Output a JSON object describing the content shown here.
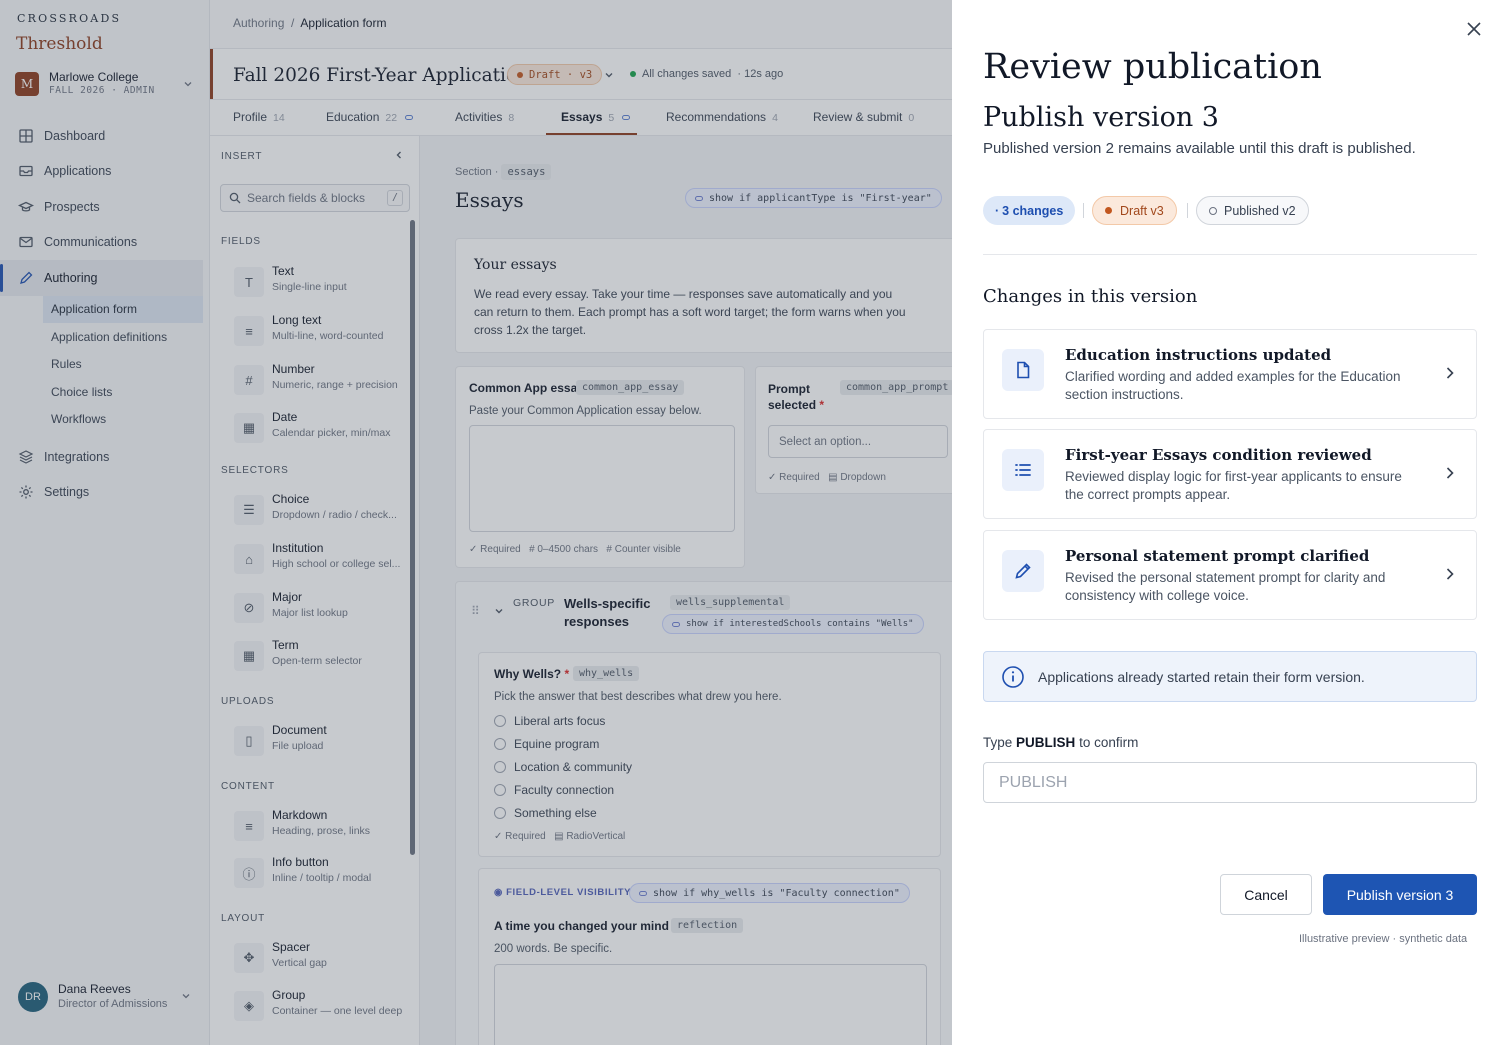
{
  "brand": {
    "line1": "CROSSROADS",
    "line2": "Threshold"
  },
  "org": {
    "initial": "M",
    "name": "Marlowe College",
    "meta": "FALL 2026 · ADMIN"
  },
  "nav": {
    "dashboard": "Dashboard",
    "applications": "Applications",
    "prospects": "Prospects",
    "communications": "Communications",
    "authoring": "Authoring",
    "sub": [
      "Application form",
      "Application definitions",
      "Rules",
      "Choice lists",
      "Workflows"
    ],
    "integrations": "Integrations",
    "settings": "Settings"
  },
  "user": {
    "initials": "DR",
    "name": "Dana Reeves",
    "role": "Director of Admissions"
  },
  "breadcrumb": {
    "parent": "Authoring",
    "sep": "/",
    "current": "Application form"
  },
  "form": {
    "title": "Fall 2026 First-Year Application",
    "badge": "Draft · v3",
    "saved": "All changes saved",
    "saved_when": "·  12s ago"
  },
  "tabs": [
    {
      "label": "Profile",
      "count": "14"
    },
    {
      "label": "Education",
      "count": "22"
    },
    {
      "label": "Activities",
      "count": "8"
    },
    {
      "label": "Essays",
      "count": "5"
    },
    {
      "label": "Recommendations",
      "count": "4"
    },
    {
      "label": "Review & submit",
      "count": "0"
    }
  ],
  "insert": {
    "header": "INSERT",
    "search_placeholder": "Search fields & blocks",
    "search_key": "/",
    "groups": {
      "fields": "FIELDS",
      "selectors": "SELECTORS",
      "uploads": "UPLOADS",
      "content": "CONTENT",
      "layout": "LAYOUT"
    },
    "items": [
      {
        "icon": "T",
        "label": "Text",
        "desc": "Single-line input"
      },
      {
        "icon": "≡",
        "label": "Long text",
        "desc": "Multi-line, word-counted"
      },
      {
        "icon": "#",
        "label": "Number",
        "desc": "Numeric, range + precision"
      },
      {
        "icon": "▦",
        "label": "Date",
        "desc": "Calendar picker, min/max"
      },
      {
        "icon": "☰",
        "label": "Choice",
        "desc": "Dropdown / radio / check..."
      },
      {
        "icon": "⌂",
        "label": "Institution",
        "desc": "High school or college sel..."
      },
      {
        "icon": "⊘",
        "label": "Major",
        "desc": "Major list lookup"
      },
      {
        "icon": "▦",
        "label": "Term",
        "desc": "Open-term selector"
      },
      {
        "icon": "▯",
        "label": "Document",
        "desc": "File upload"
      },
      {
        "icon": "≡",
        "label": "Markdown",
        "desc": "Heading, prose, links"
      },
      {
        "icon": "ⓘ",
        "label": "Info button",
        "desc": "Inline / tooltip / modal"
      },
      {
        "icon": "✥",
        "label": "Spacer",
        "desc": "Vertical gap"
      },
      {
        "icon": "◈",
        "label": "Group",
        "desc": "Container — one level deep"
      }
    ]
  },
  "section": {
    "label": "Section",
    "key": "essays",
    "title": "Essays",
    "visibility": "show if applicantType is \"First-year\""
  },
  "intro": {
    "title": "Your essays",
    "body": "We read every essay. Take your time — responses save automatically and you can return to them. Each prompt has a soft word target; the form warns when you cross 1.2x the target."
  },
  "common": {
    "label": "Common App essay",
    "key": "common_app_essay",
    "help": "Paste your Common Application essay below.",
    "meta": [
      "✓ Required",
      "# 0–4500 chars",
      "# Counter visible"
    ]
  },
  "prompt": {
    "label": "Prompt selected",
    "key": "common_app_prompt",
    "placeholder": "Select an option...",
    "meta": [
      "✓ Required",
      "▤ Dropdown"
    ]
  },
  "group": {
    "tag": "GROUP",
    "title": "Wells-specific responses",
    "key": "wells_supplemental",
    "visibility": "show if interestedSchools contains \"Wells\""
  },
  "why": {
    "label": "Why Wells?",
    "key": "why_wells",
    "help": "Pick the answer that best describes what drew you here.",
    "options": [
      "Liberal arts focus",
      "Equine program",
      "Location & community",
      "Faculty connection",
      "Something else"
    ],
    "meta": [
      "✓ Required",
      "▤ RadioVertical"
    ]
  },
  "reflection": {
    "tag": "FIELD-LEVEL VISIBILITY",
    "visibility": "show if why_wells is \"Faculty connection\"",
    "label": "A time you changed your mind",
    "key": "reflection",
    "help": "200 words. Be specific."
  },
  "panel": {
    "title": "Review publication",
    "subtitle": "Publish version 3",
    "lede": "Published version 2 remains available until this draft is published.",
    "pills": {
      "changes": "3  changes",
      "draft": "Draft  v3",
      "published": "Published  v2"
    },
    "changes_heading": "Changes in this version",
    "changes": [
      {
        "icon": "document-icon",
        "title": "Education instructions updated",
        "desc": "Clarified wording and added examples for the Education section instructions."
      },
      {
        "icon": "list-icon",
        "title": "First-year Essays condition reviewed",
        "desc": "Reviewed display logic for first-year applicants to ensure the correct prompts appear."
      },
      {
        "icon": "pencil-icon",
        "title": "Personal statement prompt clarified",
        "desc": "Revised the personal statement prompt for clarity and consistency with college voice."
      }
    ],
    "info": "Applications already started retain their form version.",
    "confirm_prefix": "Type",
    "confirm_word": "PUBLISH",
    "confirm_suffix": "to confirm",
    "input_placeholder": "PUBLISH",
    "cancel": "Cancel",
    "publish": "Publish version 3",
    "footnote": "Illustrative preview · synthetic data"
  },
  "colors": {
    "brand": "#8b3a1c",
    "primary": "#1e55b3",
    "overlay": "rgba(71,78,92,0.30)"
  }
}
